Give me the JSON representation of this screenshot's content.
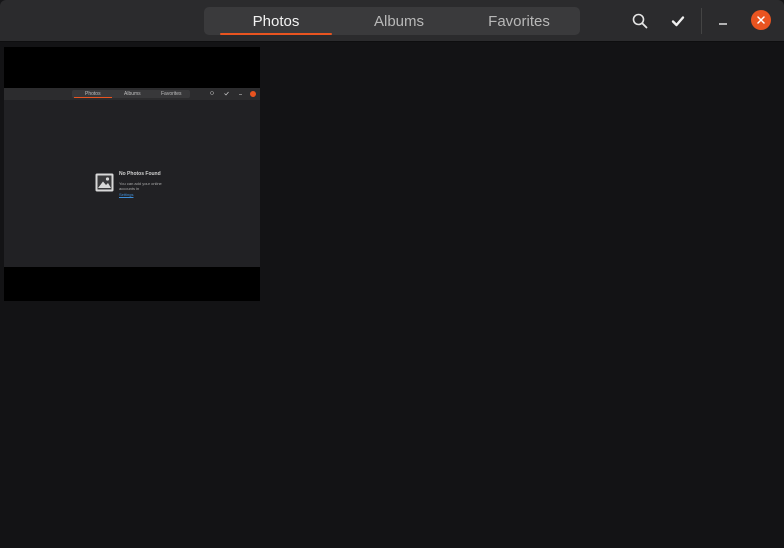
{
  "window": {
    "accent_color": "#e95420",
    "background": "#131315"
  },
  "header": {
    "tabs": [
      {
        "label": "Photos",
        "active": true
      },
      {
        "label": "Albums",
        "active": false
      },
      {
        "label": "Favorites",
        "active": false
      }
    ],
    "icons": {
      "search": "search-icon",
      "select": "checkmark-icon",
      "minimize": "minimize-icon",
      "close": "close-icon"
    }
  },
  "content": {
    "thumbnail": {
      "tabs": [
        "Photos",
        "Albums",
        "Favorites"
      ],
      "empty_title": "No Photos Found",
      "empty_text": "You can add your online accounts in",
      "empty_link": "Settings"
    }
  }
}
